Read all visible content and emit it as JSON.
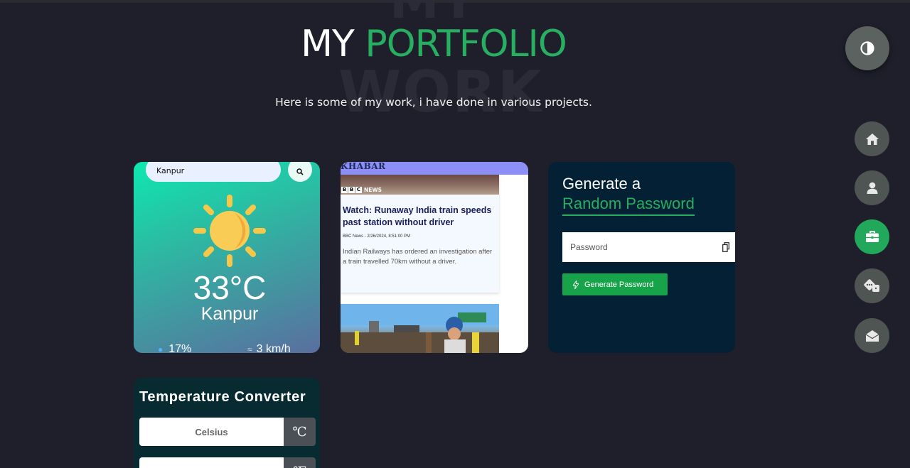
{
  "header": {
    "bg_word_1": "MY",
    "bg_word_2": "WORK",
    "title_part1": "MY ",
    "title_part2": "PORTFOLIO",
    "subtitle": "Here is some of my work, i have done in various projects."
  },
  "weather_card": {
    "search_value": "Kanpur",
    "temperature": "33°C",
    "city": "Kanpur",
    "humidity": "17%",
    "wind": "3 km/h",
    "icon": "sun-icon"
  },
  "news_card": {
    "brand": "KHABAR",
    "source_badge": "NEWS",
    "headline": "Watch: Runaway India train speeds past station without driver",
    "meta": "BBC News - 2/26/2024, 8:51:00 PM",
    "description": "Indian Railways has ordered an investigation after a train travelled 70km without a driver."
  },
  "password_card": {
    "heading_line1": "Generate a",
    "heading_line2": "Random Password",
    "placeholder": "Password",
    "button_label": "Generate Password"
  },
  "converter_card": {
    "title": "Temperature Converter",
    "input1_placeholder": "Celsius",
    "unit1": "℃",
    "unit2": "℉"
  },
  "controls": {
    "theme_toggle_icon": "contrast-icon",
    "nav_items": [
      {
        "icon": "home-icon",
        "active": false
      },
      {
        "icon": "user-icon",
        "active": false
      },
      {
        "icon": "briefcase-icon",
        "active": true
      },
      {
        "icon": "gamepad-icon",
        "active": false
      },
      {
        "icon": "envelope-open-icon",
        "active": false
      }
    ]
  },
  "colors": {
    "accent": "#27ae60",
    "background": "#1f1f2b",
    "active_nav": "#22a85a"
  }
}
